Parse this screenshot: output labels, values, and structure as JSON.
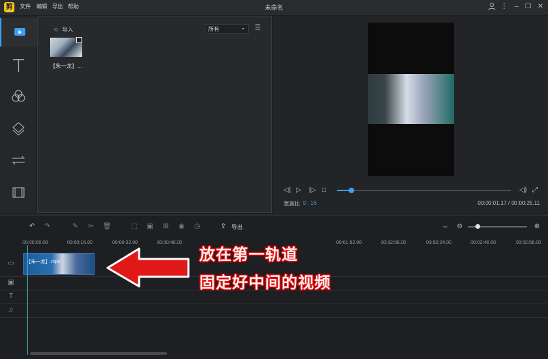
{
  "app": {
    "logo_glyph": "剪",
    "title": "未命名"
  },
  "menu": [
    {
      "label": "文件"
    },
    {
      "label": "编辑"
    },
    {
      "label": "导出"
    },
    {
      "label": "帮助"
    }
  ],
  "media": {
    "import_label": "导入",
    "filter_value": "所有",
    "items": [
      {
        "label": "【朱一龙】..."
      }
    ]
  },
  "preview": {
    "ratio_label": "宽高比",
    "ratio_value": "9 : 16",
    "timecode": "00:00:01.17 / 00:00:25.11",
    "progress": 0.084
  },
  "timeline": {
    "export_label": "导出",
    "ticks": [
      "00:00:00.00",
      "00:00:16.00",
      "00:00:32.00",
      "00:00:48.00",
      "00:01:52.00",
      "00:02:08.00",
      "00:02:24.00",
      "00:02:40.00",
      "00:02:56.00"
    ],
    "clip_label": "【朱一龙】.mp4",
    "zoom": 0.16
  },
  "annotation": {
    "line1": "放在第一轨道",
    "line2": "固定好中间的视频"
  },
  "colors": {
    "accent": "#3da0f5",
    "arrow": "#e01818",
    "playhead": "#3fbfb0"
  }
}
